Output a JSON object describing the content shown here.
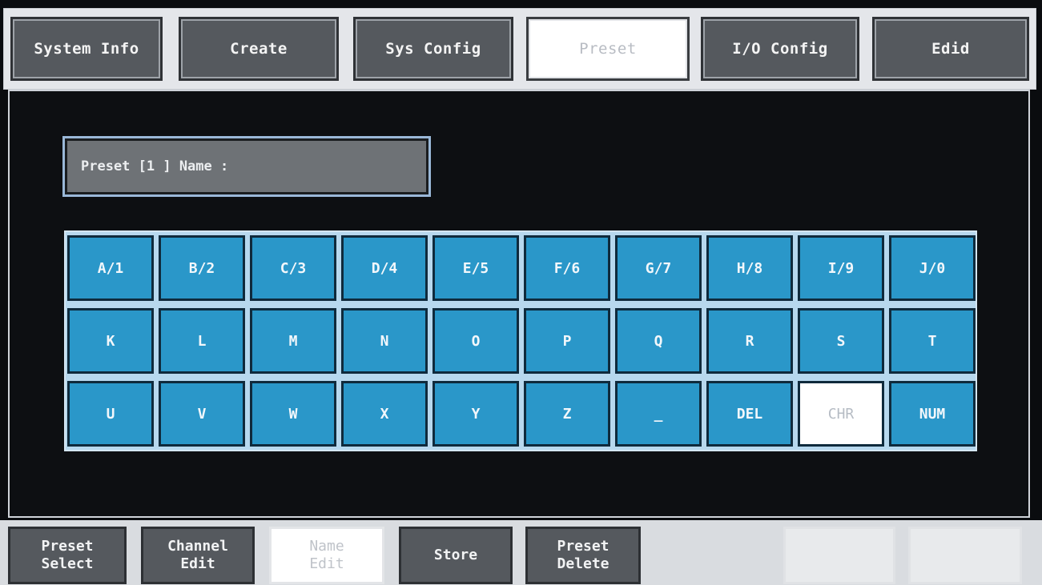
{
  "tabs": [
    {
      "label": "System Info",
      "active": false
    },
    {
      "label": "Create",
      "active": false
    },
    {
      "label": "Sys Config",
      "active": false
    },
    {
      "label": "Preset",
      "active": true
    },
    {
      "label": "I/O Config",
      "active": false
    },
    {
      "label": "Edid",
      "active": false
    }
  ],
  "name_field": {
    "text": "Preset [1 ] Name :"
  },
  "keyboard": {
    "row1": [
      "A/1",
      "B/2",
      "C/3",
      "D/4",
      "E/5",
      "F/6",
      "G/7",
      "H/8",
      "I/9",
      "J/0"
    ],
    "row2": [
      "K",
      "L",
      "M",
      "N",
      "O",
      "P",
      "Q",
      "R",
      "S",
      "T"
    ],
    "row3": [
      "U",
      "V",
      "W",
      "X",
      "Y",
      "Z",
      "_",
      "DEL",
      "CHR",
      "NUM"
    ],
    "selected": "CHR"
  },
  "bottom": {
    "preset_select": "Preset\nSelect",
    "channel_edit": "Channel\nEdit",
    "name_edit": "Name\nEdit",
    "store": "Store",
    "preset_delete": "Preset\nDelete"
  },
  "colors": {
    "key_blue": "#2a97c9",
    "tab_gray": "#55595e",
    "active_white": "#ffffff"
  }
}
